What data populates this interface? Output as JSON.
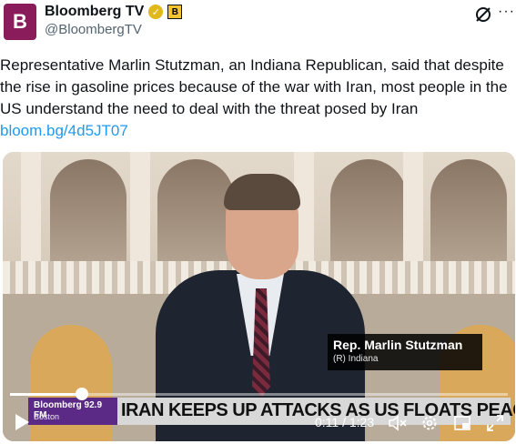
{
  "account": {
    "avatar_letter": "B",
    "display_name": "Bloomberg TV",
    "handle": "@BloombergTV",
    "verified_color": "#e2b719",
    "affiliate_badge": "B"
  },
  "tweet": {
    "text": "Representative Marlin Stutzman, an Indiana Republican, said that despite the rise in gasoline prices because of the war with Iran, most people in the US understand the need to deal with the threat posed by Iran ",
    "link": "bloom.bg/4d5JT07",
    "link_color": "#1d9bf0"
  },
  "video": {
    "lower_third_name": "Rep. Marlin Stutzman",
    "lower_third_sub": "(R) Indiana",
    "station_name": "Bloomberg 92.9 FM",
    "station_city": "Boston",
    "ticker_text": "IRAN KEEPS UP ATTACKS AS US FLOATS PEACE PLAN",
    "time_display": "0:11 / 1:23",
    "progress_fraction": 0.145
  },
  "icons": {
    "grok": "grok-icon",
    "more": "more-icon",
    "play": "play-icon",
    "mute": "mute-icon",
    "settings": "settings-icon",
    "pip": "pip-icon",
    "fullscreen": "fullscreen-icon"
  }
}
